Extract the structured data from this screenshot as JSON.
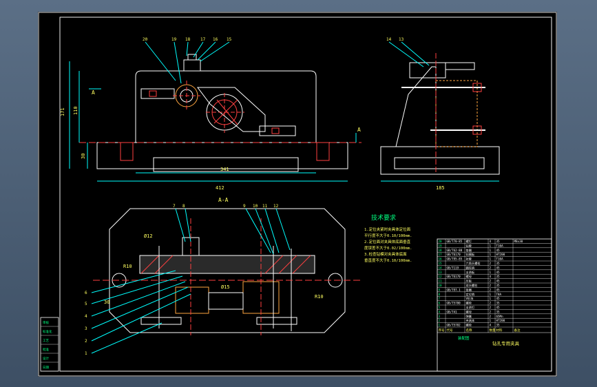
{
  "drawing": {
    "section_label": "A-A",
    "view_mark": "A",
    "tech_title": "技术要求",
    "tech_lines": [
      "1.定位夹紧时夹具体定位面",
      "  平行度不大于0.10/100mm.",
      "2.定位面对夹具体底面垂直",
      "  度误差不大于0.02/100mm.",
      "3.检查钻模对夹具体底面",
      "  垂直度不大于0.10/100mm."
    ],
    "dims": {
      "width_total": "412",
      "width_inner": "341",
      "height_total": "171",
      "height_inner": "110",
      "base_h": "30",
      "side_width": "185",
      "r_left": "R10",
      "r_right": "R10",
      "d1": "Ø12",
      "d2": "Ø15",
      "d3": "30"
    },
    "top_balloons": [
      "20",
      "19",
      "18",
      "17",
      "16",
      "15"
    ],
    "side_balloons": [
      "14",
      "13"
    ],
    "section_top_balloons": [
      "7",
      "8",
      "9",
      "10",
      "11",
      "12"
    ],
    "left_balloons": [
      "6",
      "5",
      "4",
      "3",
      "2",
      "1"
    ],
    "title_block": {
      "name": "钻孔专用夹具",
      "drawing_no": "装配图",
      "col_headers": [
        "序号",
        "代号",
        "名称",
        "数量",
        "材料",
        "备注"
      ]
    },
    "parts": [
      [
        "20",
        "GB/T70-85",
        "螺钉",
        "4",
        "35",
        "M8x30"
      ],
      [
        "19",
        "",
        "钻套",
        "1",
        "T10A",
        ""
      ],
      [
        "18",
        "GB/T62-88",
        "垫圈",
        "1",
        "45",
        ""
      ],
      [
        "17",
        "GB/T6170",
        "钻模板",
        "1",
        "HT200",
        ""
      ],
      [
        "16",
        "GB/T95-85",
        "衬套",
        "1",
        "T10A",
        ""
      ],
      [
        "15",
        "",
        "六角头螺栓",
        "2",
        "35",
        ""
      ],
      [
        "14",
        "GB/T119",
        "圆柱销",
        "2",
        "45",
        ""
      ],
      [
        "13",
        "",
        "支承板",
        "1",
        "45",
        ""
      ],
      [
        "12",
        "GB/T6170",
        "螺母",
        "4",
        "35",
        ""
      ],
      [
        "11",
        "",
        "压板",
        "2",
        "45",
        ""
      ],
      [
        "10",
        "",
        "双头螺柱",
        "2",
        "35",
        ""
      ],
      [
        "9",
        "GB/T97.1",
        "垫圈",
        "2",
        "45",
        ""
      ],
      [
        "8",
        "",
        "定位销",
        "1",
        "T8A",
        ""
      ],
      [
        "7",
        "",
        "V形块",
        "1",
        "45",
        ""
      ],
      [
        "6",
        "GB/T5780",
        "螺栓",
        "2",
        "35",
        ""
      ],
      [
        "5",
        "",
        "支承钉",
        "2",
        "45",
        ""
      ],
      [
        "4",
        "GB/T41",
        "螺母",
        "2",
        "35",
        ""
      ],
      [
        "3",
        "",
        "弹簧",
        "2",
        "65Mn",
        ""
      ],
      [
        "2",
        "",
        "夹具体",
        "1",
        "HT200",
        ""
      ],
      [
        "1",
        "GB/T5782",
        "螺栓",
        "4",
        "35",
        ""
      ]
    ],
    "side_table": [
      "审核",
      "标准化",
      "工艺",
      "批准",
      "设计",
      "日期"
    ]
  }
}
